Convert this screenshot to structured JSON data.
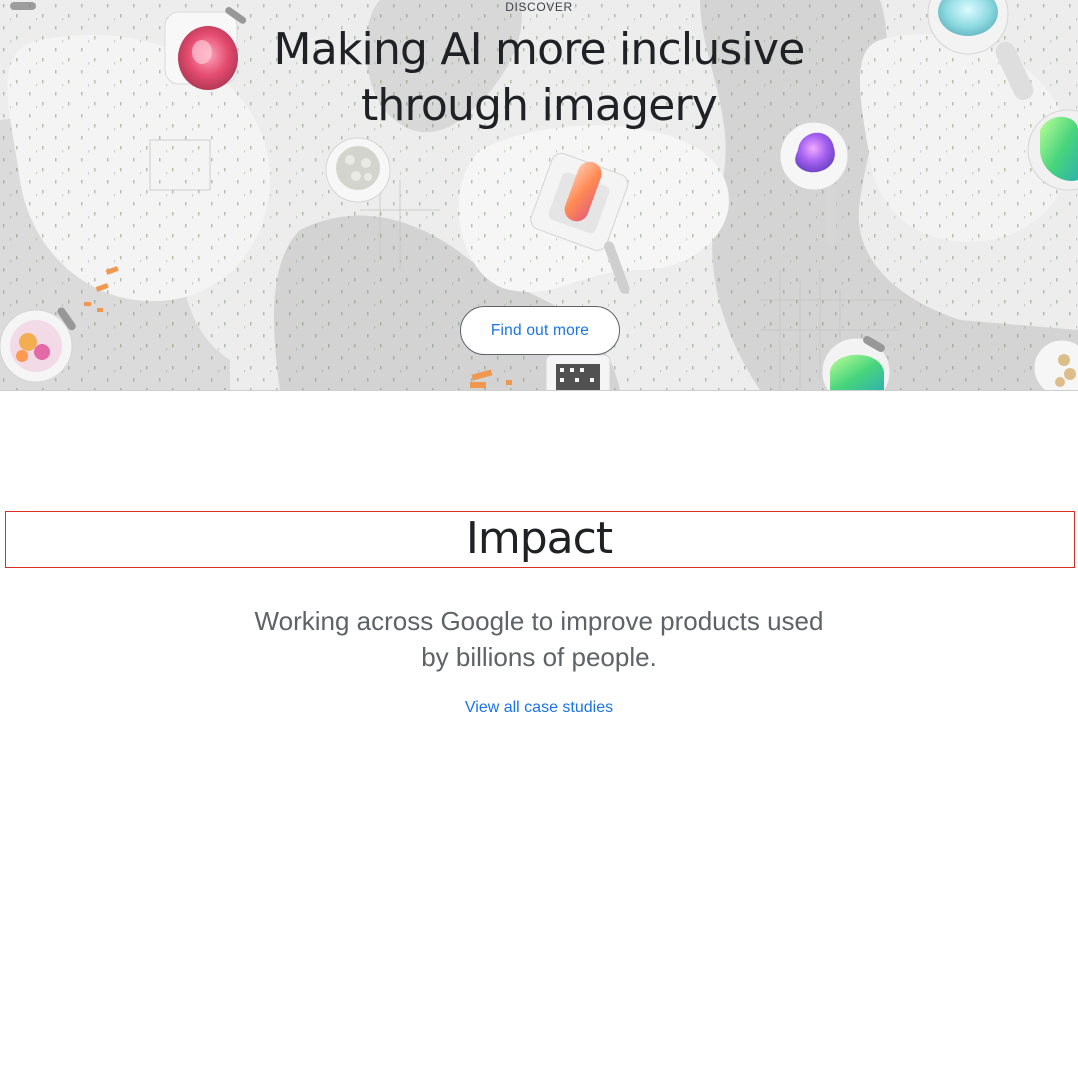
{
  "hero": {
    "eyebrow": "DISCOVER",
    "title": "Making AI more inclusive through imagery",
    "cta_label": "Find out more"
  },
  "impact": {
    "heading": "Impact",
    "description": "Working across Google to improve products used by billions of people.",
    "link_label": "View all case studies"
  },
  "colors": {
    "link": "#1a73e8",
    "heading_text": "#202124",
    "body_text": "#5f6368",
    "hero_background": "#e9e9e9",
    "focus_outline": "#d93025"
  }
}
